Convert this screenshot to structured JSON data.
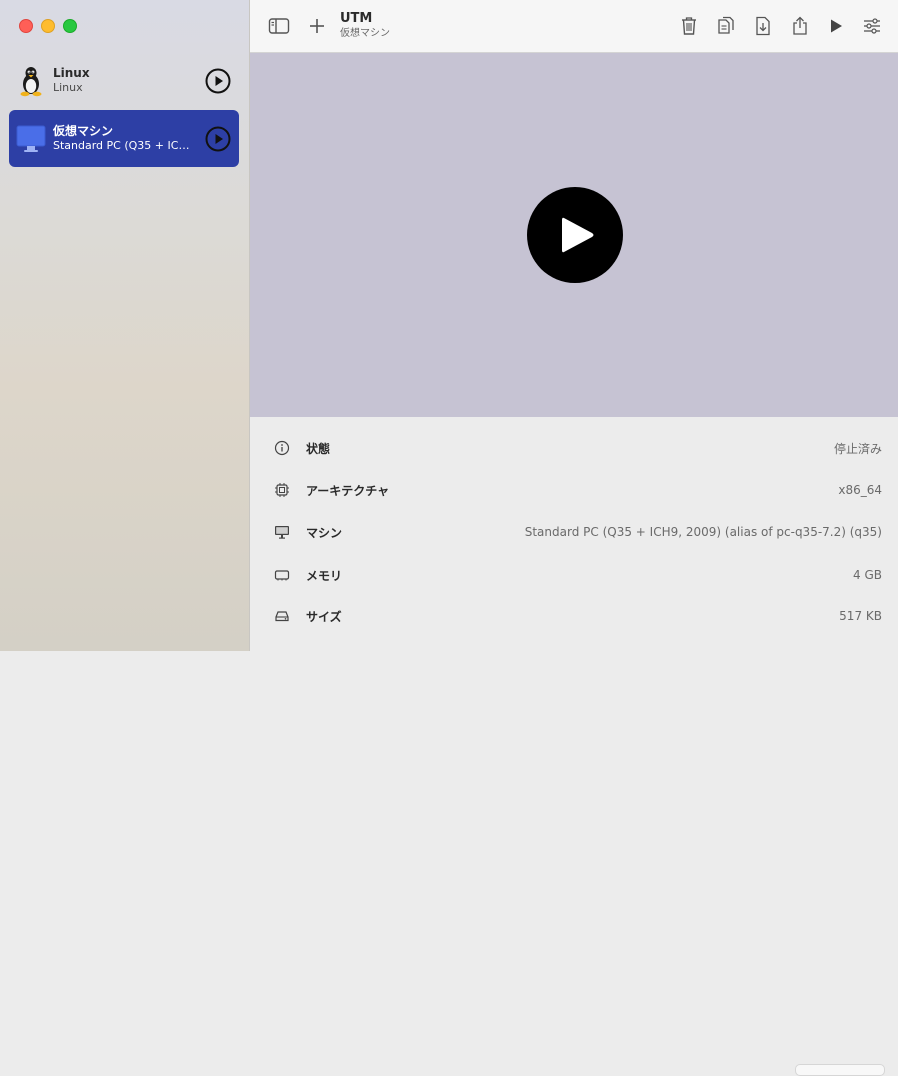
{
  "window": {
    "traffic_lights": {
      "close": "#ff5f57",
      "minimize": "#febc2e",
      "zoom": "#28c840"
    }
  },
  "sidebar": {
    "items": [
      {
        "name": "Linux",
        "subtitle": "Linux",
        "icon": "linux-penguin-icon",
        "selected": false
      },
      {
        "name": "仮想マシン",
        "subtitle": "Standard PC (Q35 + ICH...",
        "icon": "monitor-icon",
        "selected": true
      }
    ],
    "selection_color": "#2d3fa5"
  },
  "toolbar": {
    "title": "UTM",
    "subtitle": "仮想マシン",
    "buttons": [
      "sidebar-toggle-icon",
      "add-icon",
      "trash-icon",
      "clone-icon",
      "download-icon",
      "share-icon",
      "run-icon",
      "settings-icon"
    ]
  },
  "screen": {
    "background": "#c6c3d3",
    "center_icon": "big-play-icon"
  },
  "details": [
    {
      "icon": "info-icon",
      "label": "状態",
      "value": "停止済み"
    },
    {
      "icon": "cpu-icon",
      "label": "アーキテクチャ",
      "value": "x86_64"
    },
    {
      "icon": "display-icon",
      "label": "マシン",
      "value": "Standard PC (Q35 + ICH9, 2009) (alias of pc-q35-7.2) (q35)"
    },
    {
      "icon": "memory-icon",
      "label": "メモリ",
      "value": "4 GB"
    },
    {
      "icon": "drive-icon",
      "label": "サイズ",
      "value": "517 KB"
    }
  ]
}
